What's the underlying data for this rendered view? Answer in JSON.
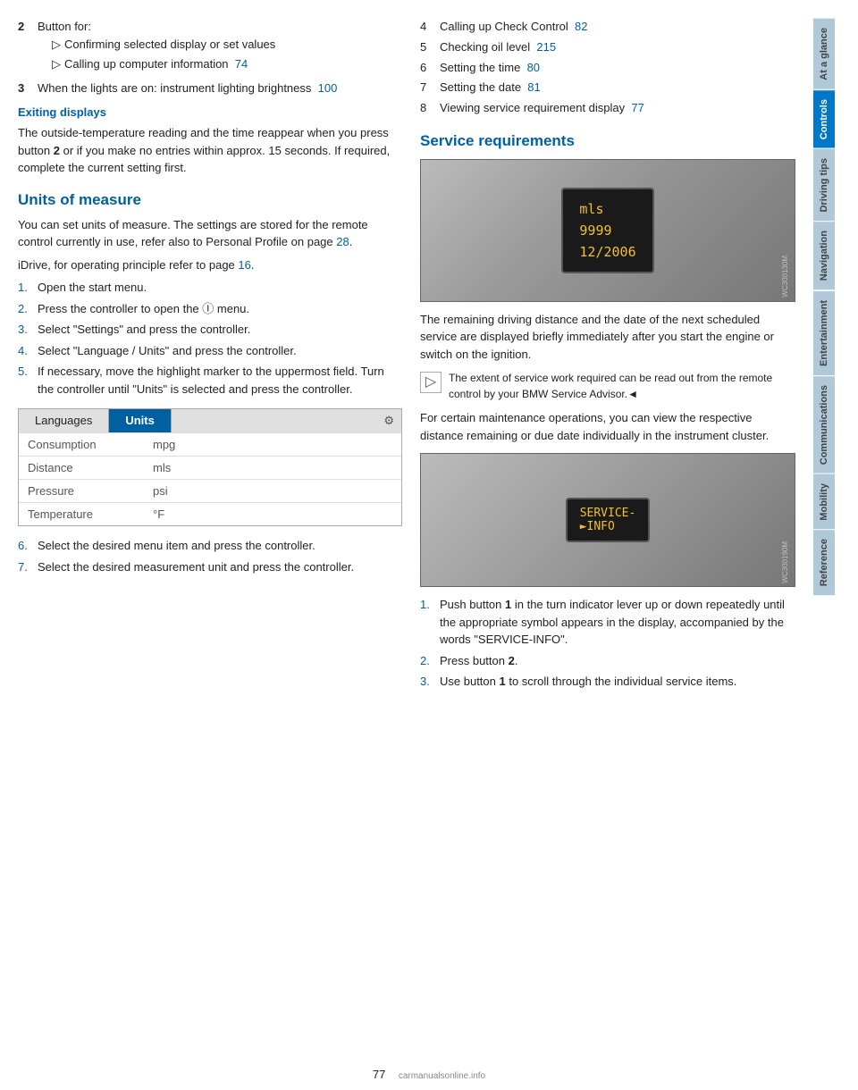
{
  "left": {
    "item2_label": "2",
    "item2_text": "Button for:",
    "bullet1": "Confirming selected display or set values",
    "bullet2": "Calling up computer information",
    "bullet2_page": "74",
    "item3_label": "3",
    "item3_text": "When the lights are on: instrument lighting brightness",
    "item3_page": "100",
    "exiting_title": "Exiting displays",
    "exiting_text": "The outside-temperature reading and the time reappear when you press button ",
    "exiting_bold": "2",
    "exiting_text2": " or if you make no entries within approx. 15 seconds. If required, complete the current setting first.",
    "units_title": "Units of measure",
    "units_p1": "You can set units of measure. The settings are stored for the remote control currently in use, refer also to Personal Profile on page ",
    "units_p1_link": "28",
    "units_p1_end": ".",
    "units_p2_start": "iDrive, for operating principle refer to page ",
    "units_p2_link": "16",
    "units_p2_end": ".",
    "steps": [
      {
        "num": "1.",
        "text": "Open the start menu."
      },
      {
        "num": "2.",
        "text": "Press the controller to open the Ⓘ menu."
      },
      {
        "num": "3.",
        "text": "Select \"Settings\" and press the controller."
      },
      {
        "num": "4.",
        "text": "Select \"Language / Units\" and press the controller."
      },
      {
        "num": "5.",
        "text": "If necessary, move the highlight marker to the uppermost field. Turn the controller until \"Units\" is selected and press the controller."
      }
    ],
    "table": {
      "tab_languages": "Languages",
      "tab_units": "Units",
      "rows": [
        {
          "label": "Consumption",
          "value": "mpg"
        },
        {
          "label": "Distance",
          "value": "mls"
        },
        {
          "label": "Pressure",
          "value": "psi"
        },
        {
          "label": "Temperature",
          "value": "°F"
        }
      ]
    },
    "step6": "6.",
    "step6_text": "Select the desired menu item and press the controller.",
    "step7": "7.",
    "step7_text": "Select the desired measurement unit and press the controller."
  },
  "right": {
    "list_items": [
      {
        "num": "4",
        "text": "Calling up Check Control",
        "page": "82"
      },
      {
        "num": "5",
        "text": "Checking oil level",
        "page": "215"
      },
      {
        "num": "6",
        "text": "Setting the time",
        "page": "80"
      },
      {
        "num": "7",
        "text": "Setting the date",
        "page": "81"
      },
      {
        "num": "8",
        "text": "Viewing service requirement display",
        "page": "77"
      }
    ],
    "service_title": "Service requirements",
    "dash_display_line1": "mls",
    "dash_display_line2": "9999",
    "dash_display_line3": "12/2006",
    "service_para": "The remaining driving distance and the date of the next scheduled service are displayed briefly immediately after you start the engine or switch on the ignition.",
    "note_text": "The extent of service work required can be read out from the remote control by your BMW Service Advisor.◄",
    "service_para2_start": "For certain maintenance operations, you can view the respective distance remaining or due date individually in the instrument cluster.",
    "service_display_line1": "SERVICE-",
    "service_display_line2": "►INFO",
    "steps2": [
      {
        "num": "1.",
        "text_start": "Push button ",
        "bold": "1",
        "text_end": " in the turn indicator lever up or down repeatedly until the appropriate symbol appears in the display, accompanied by the words \"SERVICE-INFO\"."
      },
      {
        "num": "2.",
        "text_start": "Press button ",
        "bold": "2",
        "text_end": "."
      },
      {
        "num": "3.",
        "text_start": "Use button ",
        "bold": "1",
        "text_end": " to scroll through the individual service items."
      }
    ]
  },
  "sidebar": {
    "tabs": [
      {
        "label": "At a glance",
        "active": false
      },
      {
        "label": "Controls",
        "active": true
      },
      {
        "label": "Driving tips",
        "active": false
      },
      {
        "label": "Navigation",
        "active": false
      },
      {
        "label": "Entertainment",
        "active": false
      },
      {
        "label": "Communications",
        "active": false
      },
      {
        "label": "Mobility",
        "active": false
      },
      {
        "label": "Reference",
        "active": false
      }
    ]
  },
  "footer": {
    "page_num": "77",
    "watermark": "carmanualsonline.info"
  }
}
